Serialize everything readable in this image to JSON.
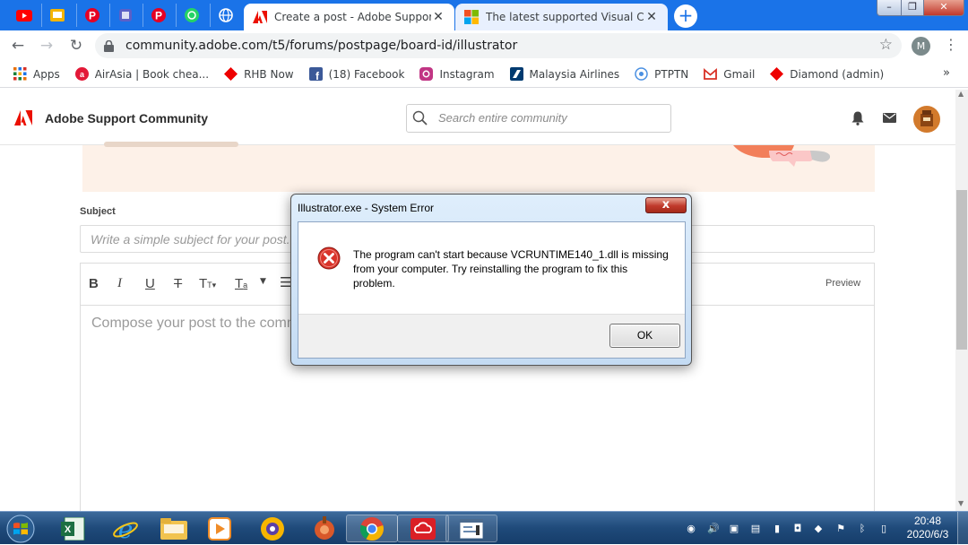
{
  "browser": {
    "tabs": [
      {
        "title": "Create a post - Adobe Support C",
        "active": true
      },
      {
        "title": "The latest supported Visual C++",
        "active": false
      }
    ],
    "new_tab_label": "+",
    "close_label": "✕",
    "window_controls": {
      "minimize": "–",
      "maximize": "❐",
      "close": "✕"
    },
    "url": "community.adobe.com/t5/forums/postpage/board-id/illustrator",
    "profile_initial": "M",
    "bookmarks": [
      {
        "label": "Apps",
        "icon": "apps-grid-icon"
      },
      {
        "label": "AirAsia | Book chea...",
        "icon": "airasia-icon"
      },
      {
        "label": "RHB Now",
        "icon": "rhb-icon"
      },
      {
        "label": "(18) Facebook",
        "icon": "facebook-icon"
      },
      {
        "label": "Instagram",
        "icon": "instagram-icon"
      },
      {
        "label": "Malaysia Airlines",
        "icon": "malaysia-airlines-icon"
      },
      {
        "label": "PTPTN",
        "icon": "ptptn-icon"
      },
      {
        "label": "Gmail",
        "icon": "gmail-icon"
      },
      {
        "label": "Diamond (admin)",
        "icon": "diamond-icon"
      }
    ],
    "bookmarks_overflow": "»"
  },
  "site": {
    "name": "Adobe Support Community",
    "search_placeholder": "Search entire community",
    "subject_label": "Subject",
    "subject_placeholder": "Write a simple subject for your post. K",
    "toolbar_buttons": [
      "B",
      "I",
      "U",
      "T",
      "T",
      "T"
    ],
    "preview_label": "Preview",
    "compose_placeholder": "Compose your post to the comm"
  },
  "dialog": {
    "title": "Illustrator.exe - System Error",
    "close_label": "x",
    "message": "The program can't start because VCRUNTIME140_1.dll is missing from your computer. Try reinstalling the program to fix this problem.",
    "ok_label": "OK"
  },
  "taskbar": {
    "time": "20:48",
    "date": "2020/6/3"
  },
  "colors": {
    "chrome_blue": "#1a73e8",
    "adobe_red": "#eb1000",
    "banner": "#fdf1e8",
    "error_red": "#d9342b"
  }
}
